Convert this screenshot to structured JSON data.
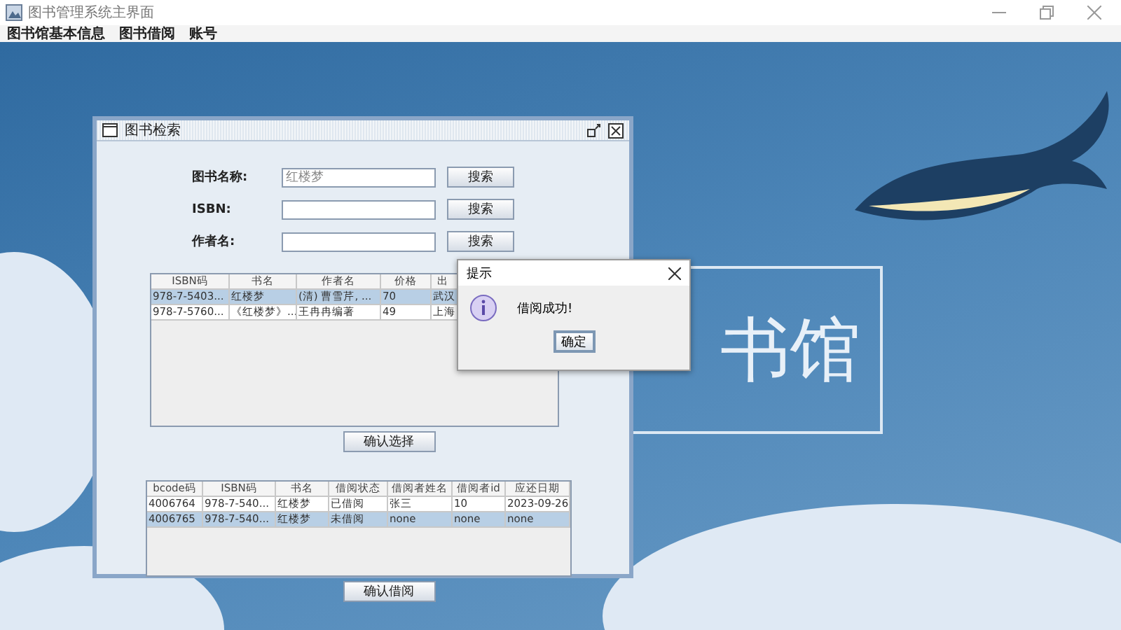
{
  "window": {
    "title": "图书管理系统主界面"
  },
  "menu": [
    {
      "label": "图书馆基本信息"
    },
    {
      "label": "图书借阅"
    },
    {
      "label": "账号"
    }
  ],
  "background": {
    "text": "书馆"
  },
  "search_frame": {
    "title": "图书检索",
    "fields": [
      {
        "label": "图书名称:",
        "value": "红楼梦",
        "button": "搜索"
      },
      {
        "label": "ISBN:",
        "button": "搜索"
      },
      {
        "label": "作者名:",
        "button": "搜索"
      }
    ],
    "books_table": {
      "columns": [
        "ISBN码",
        "书名",
        "作者名",
        "价格",
        "出"
      ],
      "rows": [
        {
          "cells": [
            "978-7-5403...",
            "红楼梦",
            "(清) 曹雪芹, ...",
            "70",
            "武汉"
          ],
          "selected": true
        },
        {
          "cells": [
            "978-7-5760...",
            "《红楼梦》...",
            "王冉冉编著",
            "49",
            "上海"
          ],
          "selected": false
        }
      ]
    },
    "confirm_select_button": "确认选择",
    "copies_table": {
      "columns": [
        "bcode码",
        "ISBN码",
        "书名",
        "借阅状态",
        "借阅者姓名",
        "借阅者id",
        "应还日期"
      ],
      "rows": [
        {
          "cells": [
            "4006764",
            "978-7-540...",
            "红楼梦",
            "已借阅",
            "张三",
            "10",
            "2023-09-26"
          ],
          "selected": false
        },
        {
          "cells": [
            "4006765",
            "978-7-540...",
            "红楼梦",
            "未借阅",
            "none",
            "none",
            "none"
          ],
          "selected": true
        }
      ]
    },
    "confirm_borrow_button": "确认借阅"
  },
  "dialog": {
    "title": "提示",
    "message": "借阅成功!",
    "button": "确定"
  }
}
